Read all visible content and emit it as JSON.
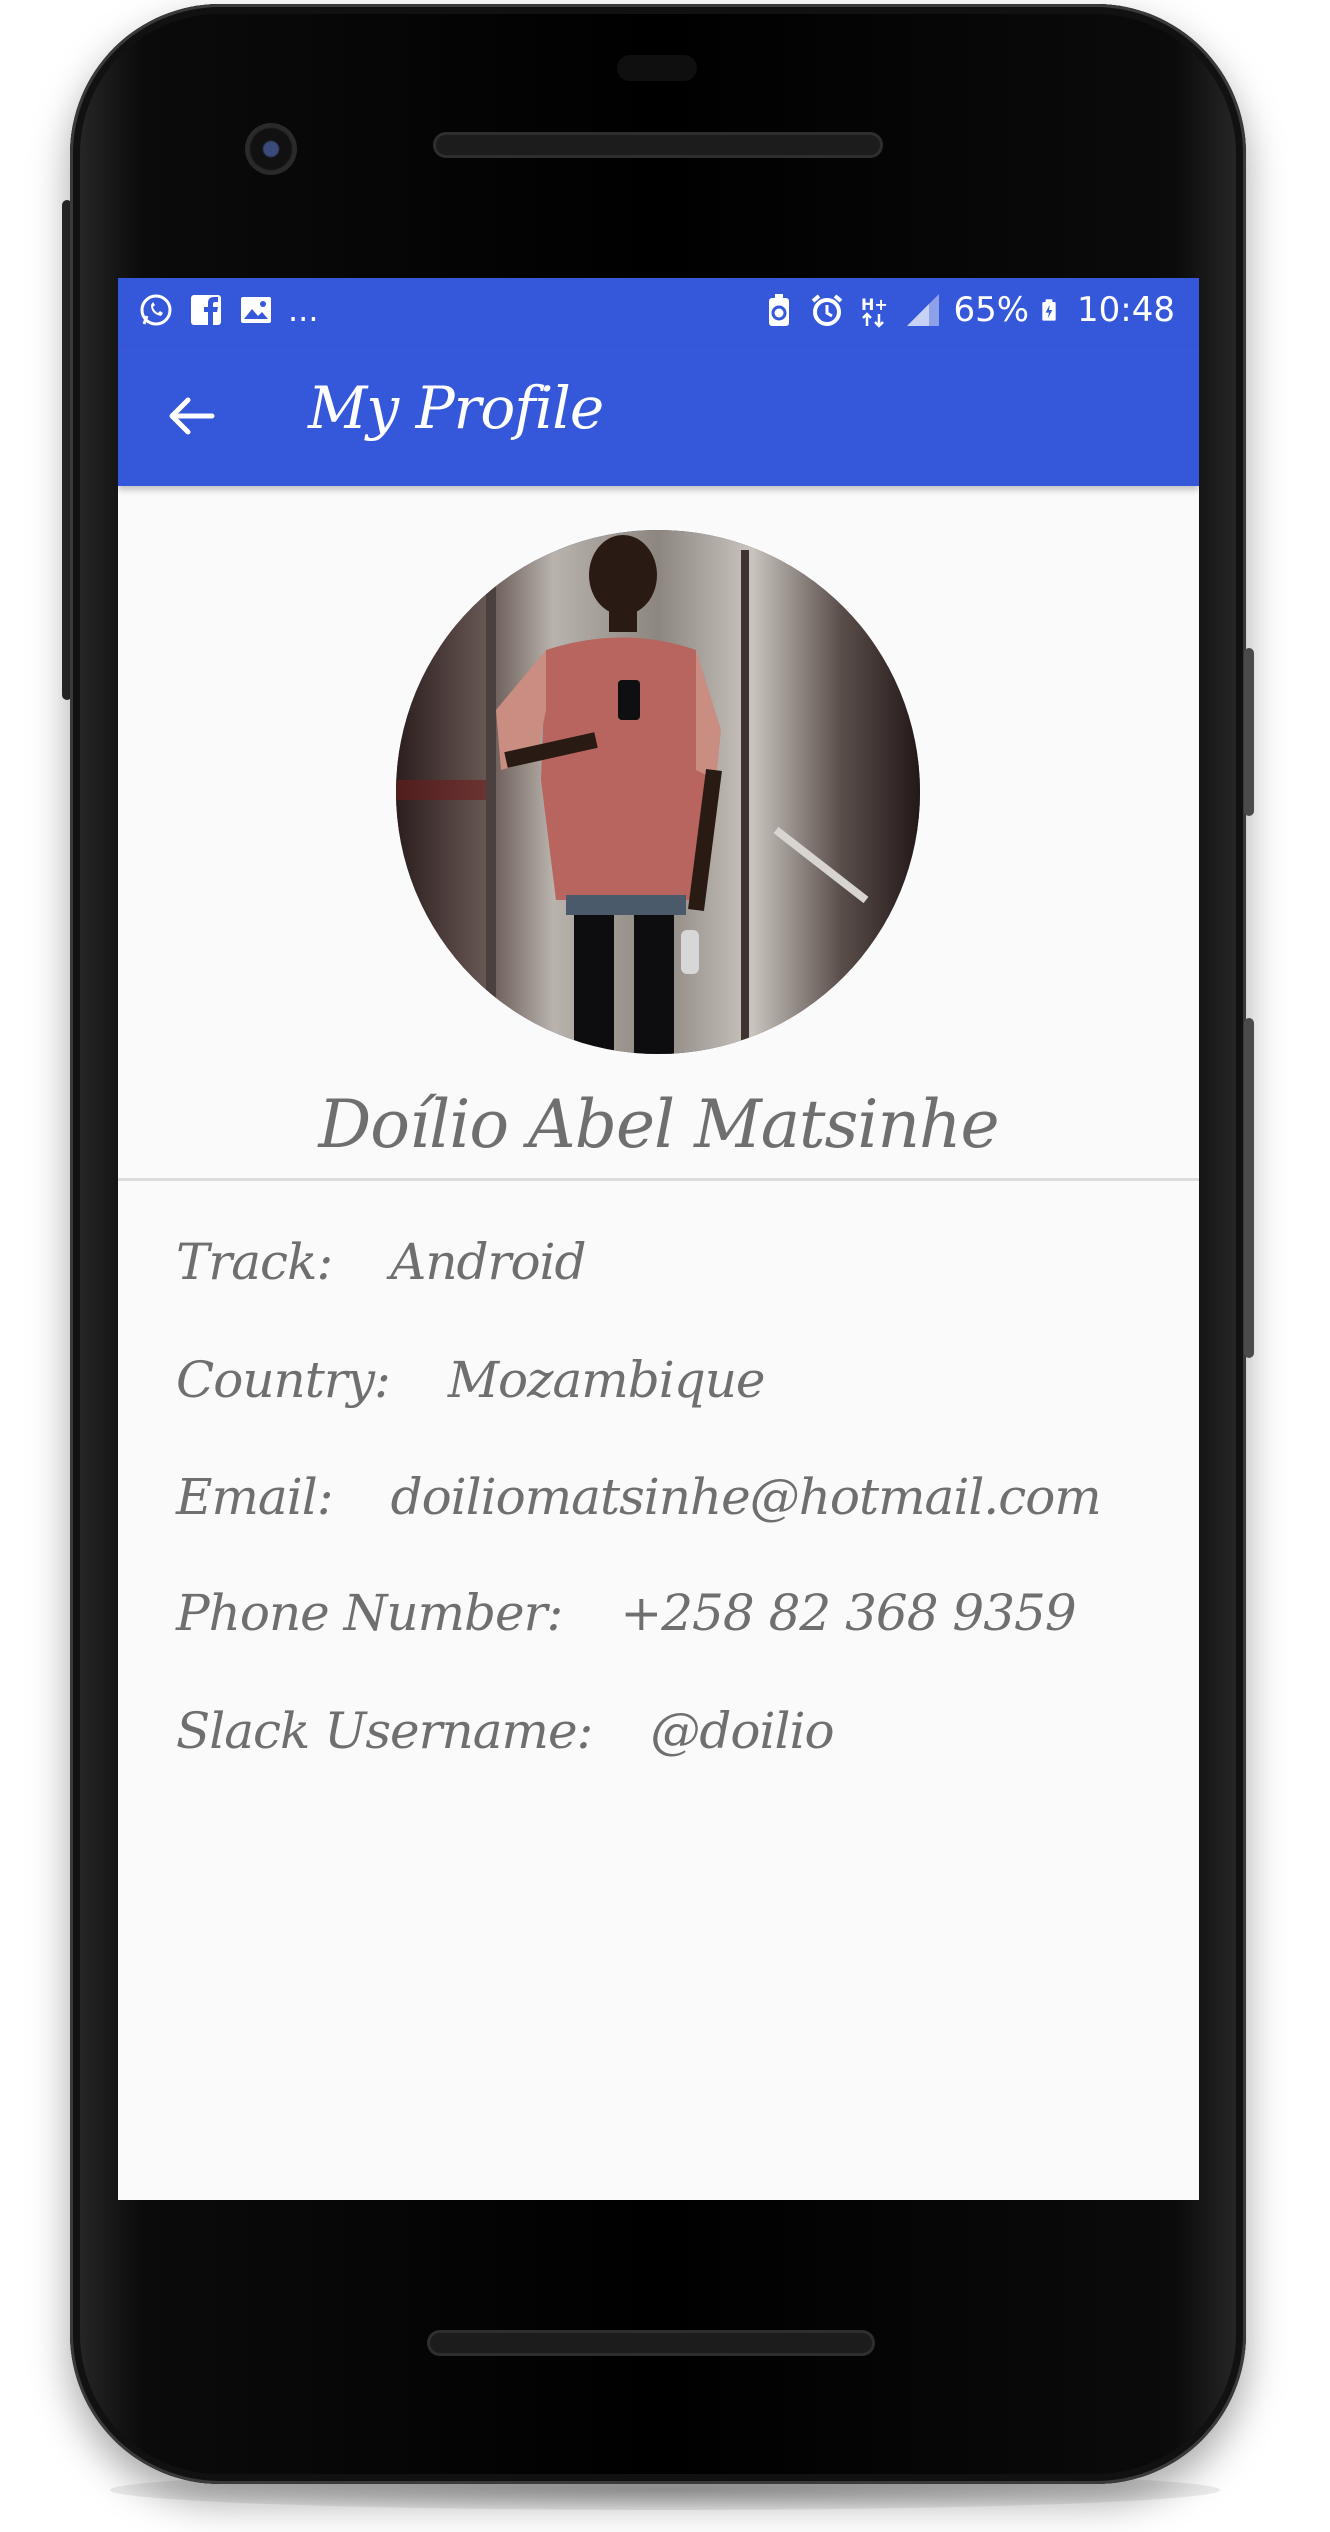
{
  "status_bar": {
    "notification_icons": [
      "whatsapp-icon",
      "facebook-icon",
      "image-icon"
    ],
    "more_indicator": "...",
    "system_icons": [
      "battery-saver-icon",
      "alarm-icon",
      "h-plus-data-icon",
      "signal-icon",
      "battery-charging-icon"
    ],
    "battery": "65%",
    "time": "10:48"
  },
  "app_bar": {
    "title": "My Profile",
    "background": "#3557d9"
  },
  "profile": {
    "name": "Doílio Abel Matsinhe",
    "fields": [
      {
        "label": "Track:",
        "value": "Android"
      },
      {
        "label": "Country:",
        "value": "Mozambique"
      },
      {
        "label": "Email:",
        "value": "doiliomatsinhe@hotmail.com"
      },
      {
        "label": "Phone Number:",
        "value": "+258 82 368 9359"
      },
      {
        "label": "Slack Username:",
        "value": "@doilio"
      }
    ]
  },
  "colors": {
    "accent": "#3557d9",
    "text": "#6f6f6f",
    "screen_bg": "#fafafa"
  }
}
